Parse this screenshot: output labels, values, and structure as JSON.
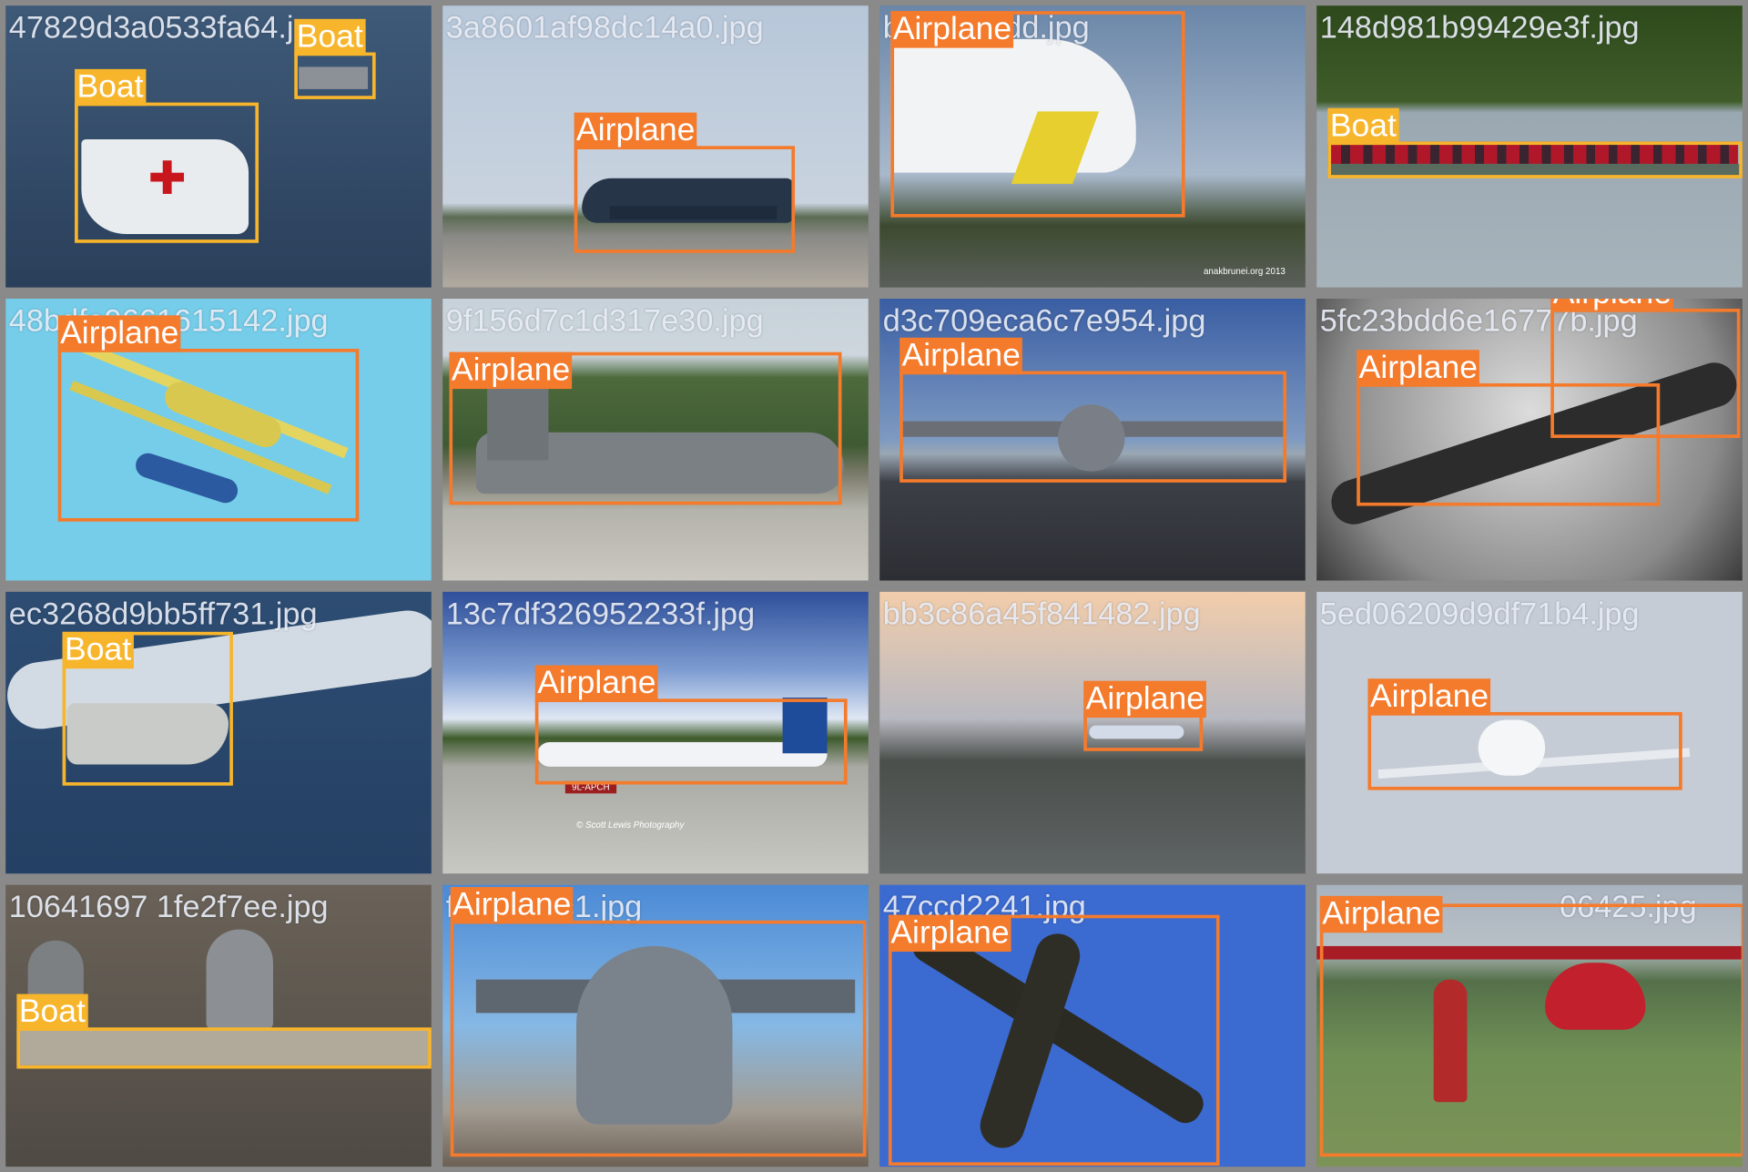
{
  "colors": {
    "boat": "#f7b52c",
    "airplane": "#f47a2c",
    "grid_bg": "#808080"
  },
  "classes": [
    "Boat",
    "Airplane"
  ],
  "tiles": [
    {
      "filename": "47829d3a0533fa64.jpg",
      "scene": "ocean",
      "labels": [
        "Boat",
        "Boat"
      ]
    },
    {
      "filename": "3a8601af98dc14a0.jpg",
      "scene": "runway-overcast",
      "labels": [
        "Airplane"
      ]
    },
    {
      "filename": "bdb9eebdd.jpg",
      "scene": "tail-closeup",
      "labels": [
        "Airplane"
      ],
      "watermark": "anakbrunei.org 2013"
    },
    {
      "filename": "148d981b99429e3f.jpg",
      "scene": "lake-dragonboat",
      "labels": [
        "Boat"
      ]
    },
    {
      "filename": "48bdfe9661615142.jpg",
      "scene": "sky-biplane",
      "labels": [
        "Airplane"
      ]
    },
    {
      "filename": "9f156d7c1d317e30.jpg",
      "scene": "hills-c130",
      "labels": [
        "Airplane"
      ]
    },
    {
      "filename": "d3c709eca6c7e954.jpg",
      "scene": "airshow-c17",
      "labels": [
        "Airplane"
      ]
    },
    {
      "filename": "5fc23bdd6e16777b.jpg",
      "scene": "bw-museum",
      "labels": [
        "Airplane",
        "Airplane"
      ]
    },
    {
      "filename": "ec3268d9bb5ff731.jpg",
      "scene": "navy-speedboat",
      "labels": [
        "Boat"
      ]
    },
    {
      "filename": "13c7df326952233f.jpg",
      "scene": "jetblue-runway",
      "labels": [
        "Airplane"
      ],
      "watermark": "© Scott Lewis Photography",
      "sign": "9L-APCH"
    },
    {
      "filename": "bb3c86a45f841482.jpg",
      "scene": "dusk-takeoff",
      "labels": [
        "Airplane"
      ]
    },
    {
      "filename": "5ed06209d9df71b4.jpg",
      "scene": "haze-jumbo",
      "labels": [
        "Airplane"
      ]
    },
    {
      "filename": "10641697 1fe2f7ee.jpg",
      "scene": "rowers",
      "labels": [
        "Boat"
      ]
    },
    {
      "filename": "f388825c1.jpg",
      "scene": "c17-crowd",
      "labels": [
        "Airplane"
      ]
    },
    {
      "filename": "47ccd2241.jpg",
      "scene": "dc3-sky",
      "labels": [
        "Airplane"
      ]
    },
    {
      "filename": "06425.jpg",
      "scene": "cessna-field",
      "labels": [
        "Airplane"
      ]
    }
  ]
}
